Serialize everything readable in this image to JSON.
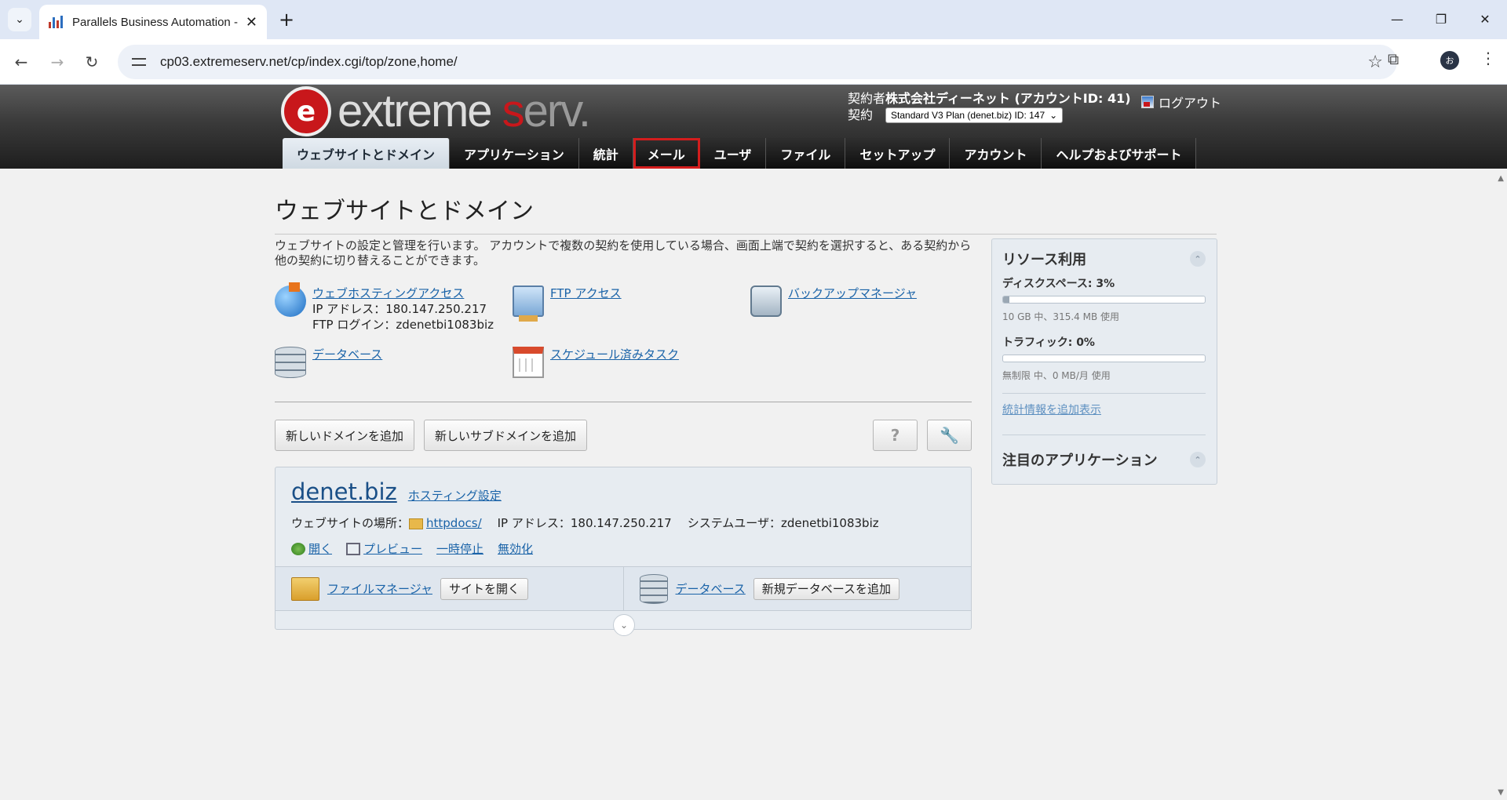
{
  "browser": {
    "tab_title": "Parallels Business Automation - ",
    "url": "cp03.extremeserv.net/cp/index.cgi/top/zone,home/",
    "profile_initial": "お"
  },
  "header": {
    "logo_e": "e",
    "logo_text_1": "extreme",
    "logo_text_2": "s",
    "logo_text_3": "erv.",
    "contractor_label": "契約者",
    "contractor_name": "株式会社ディーネット (アカウントID: 41)",
    "contract_label": "契約",
    "plan_selected": "Standard V3 Plan (denet.biz) ID: 147",
    "logout_label": "ログアウト"
  },
  "nav": {
    "tabs": [
      "ウェブサイトとドメイン",
      "アプリケーション",
      "統計",
      "メール",
      "ユーザ",
      "ファイル",
      "セットアップ",
      "アカウント",
      "ヘルプおよびサポート"
    ]
  },
  "page": {
    "title": "ウェブサイトとドメイン",
    "intro": "ウェブサイトの設定と管理を行います。 アカウントで複数の契約を使用している場合、画面上端で契約を選択すると、ある契約から他の契約に切り替えることができます。"
  },
  "tools": {
    "hosting_link": "ウェブホスティングアクセス",
    "hosting_ip": "IP アドレス：180.147.250.217",
    "hosting_ftp": "FTP ログイン：zdenetbi1083biz",
    "ftp_link": "FTP アクセス",
    "backup_link": "バックアップマネージャ",
    "db_link": "データベース",
    "tasks_link": "スケジュール済みタスク"
  },
  "buttons": {
    "add_domain": "新しいドメインを追加",
    "add_subdomain": "新しいサブドメインを追加",
    "help": "?",
    "settings": "🔧"
  },
  "domain": {
    "name": "denet.biz",
    "hosting_settings": "ホスティング設定",
    "location_label": "ウェブサイトの場所：",
    "location_folder": "httpdocs/",
    "ip": "IP アドレス：180.147.250.217",
    "system_user": "システムユーザ：zdenetbi1083biz",
    "actions": [
      "開く",
      "プレビュー",
      "一時停止",
      "無効化"
    ],
    "file_manager": "ファイルマネージャ",
    "open_site": "サイトを開く",
    "database": "データベース",
    "add_database": "新規データベースを追加"
  },
  "sidebar": {
    "resources_title": "リソース利用",
    "disk_label": "ディスクスペース: 3%",
    "disk_percent": 3,
    "disk_note": "10 GB 中、315.4 MB 使用",
    "traffic_label": "トラフィック: 0%",
    "traffic_percent": 0,
    "traffic_note": "無制限 中、0 MB/月 使用",
    "more_stats": "統計情報を追加表示",
    "featured_title": "注目のアプリケーション"
  }
}
